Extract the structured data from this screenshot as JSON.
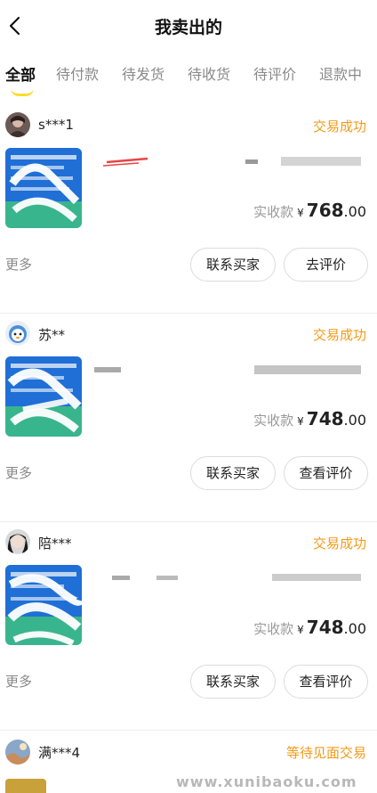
{
  "header": {
    "title": "我卖出的",
    "back_icon": "chevron-left-icon"
  },
  "tabs": [
    {
      "label": "全部",
      "active": true
    },
    {
      "label": "待付款",
      "active": false
    },
    {
      "label": "待发货",
      "active": false
    },
    {
      "label": "待收货",
      "active": false
    },
    {
      "label": "待评价",
      "active": false
    },
    {
      "label": "退款中",
      "active": false
    }
  ],
  "orders": [
    {
      "buyer": "s***1",
      "status": "交易成功",
      "price_label": "实收款",
      "currency": "¥",
      "price_int": "768",
      "price_dec": ".00",
      "more": "更多",
      "contact_button": "联系买家",
      "review_button": "去评价"
    },
    {
      "buyer": "苏**",
      "status": "交易成功",
      "price_label": "实收款",
      "currency": "¥",
      "price_int": "748",
      "price_dec": ".00",
      "more": "更多",
      "contact_button": "联系买家",
      "review_button": "查看评价"
    },
    {
      "buyer": "陪***",
      "status": "交易成功",
      "price_label": "实收款",
      "currency": "¥",
      "price_int": "748",
      "price_dec": ".00",
      "more": "更多",
      "contact_button": "联系买家",
      "review_button": "查看评价"
    },
    {
      "buyer": "满***4",
      "status": "等待见面交易"
    }
  ],
  "watermark": "www.xunibaoku.com",
  "colors": {
    "accent_yellow": "#ffdb2e",
    "status_orange": "#f39a18",
    "thumb_blue": "#1f6fd6",
    "thumb_green": "#37b98a"
  }
}
